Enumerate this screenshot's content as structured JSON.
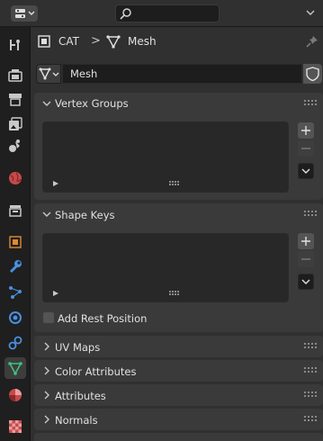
{
  "header": {
    "editor_icon": "properties-editor-icon",
    "search_icon": "search-icon"
  },
  "tabs": [
    {
      "icon": "tool-icon",
      "color": "#c0c0c0"
    },
    {
      "icon": "render-icon",
      "color": "#c0c0c0"
    },
    {
      "icon": "output-icon",
      "color": "#c0c0c0"
    },
    {
      "icon": "view-layer-icon",
      "color": "#c0c0c0"
    },
    {
      "icon": "scene-icon",
      "color": "#c0c0c0"
    },
    {
      "icon": "world-icon",
      "color": "#d04040"
    },
    {
      "icon": "collection-icon",
      "color": "#c0c0c0"
    },
    {
      "icon": "object-icon",
      "color": "#e08a30"
    },
    {
      "icon": "modifier-icon",
      "color": "#4a90e0"
    },
    {
      "icon": "particles-icon",
      "color": "#4a90e0"
    },
    {
      "icon": "physics-icon",
      "color": "#4a90e0"
    },
    {
      "icon": "constraints-icon",
      "color": "#4a90e0"
    },
    {
      "icon": "mesh-data-icon",
      "color": "#40c080",
      "active": true
    },
    {
      "icon": "material-icon",
      "color": "#d04040"
    },
    {
      "icon": "texture-icon",
      "color": "#d04040"
    }
  ],
  "breadcrumb": {
    "object_name": "CAT",
    "separator": ">",
    "data_name": "Mesh"
  },
  "datablock": {
    "name": "Mesh"
  },
  "panels": {
    "vertex_groups": {
      "title": "Vertex Groups"
    },
    "shape_keys": {
      "title": "Shape Keys",
      "add_rest_position": "Add Rest Position"
    },
    "collapsed": [
      {
        "title": "UV Maps"
      },
      {
        "title": "Color Attributes"
      },
      {
        "title": "Attributes"
      },
      {
        "title": "Normals"
      }
    ]
  },
  "colors": {
    "accent_mesh": "#40c080",
    "panel_bg": "#3a3a3a",
    "list_bg": "#282828"
  }
}
